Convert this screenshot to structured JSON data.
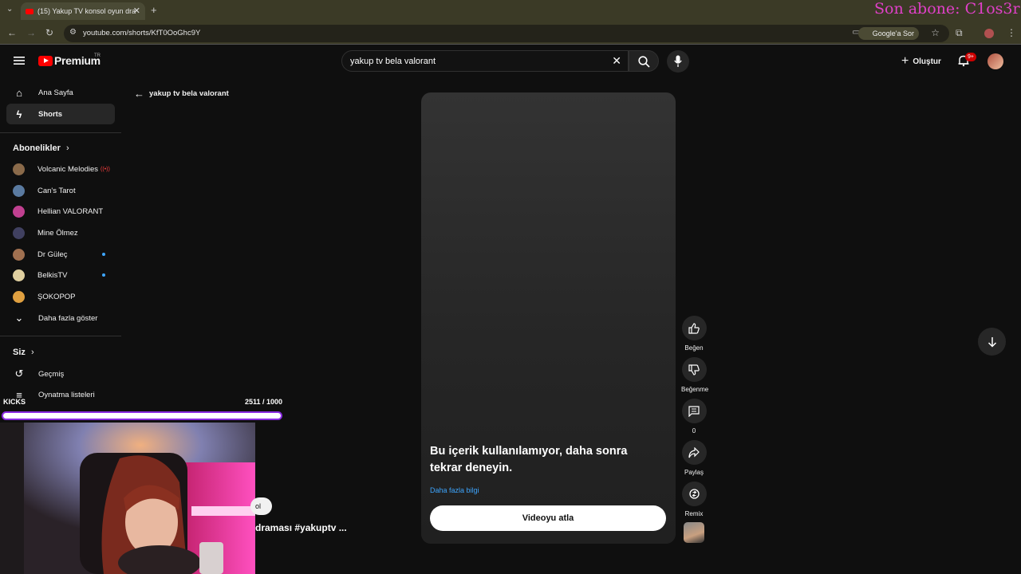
{
  "browser": {
    "tab_title": "(15) Yakup TV konsol oyun dra",
    "url": "youtube.com/shorts/KfT0OoGhc9Y",
    "google_sor": "Google'a Sor"
  },
  "stream_overlay": {
    "son_abone": "Son abone: C1os3r",
    "kicks_label": "KICKS",
    "kicks_count": "2511 / 1000",
    "kicks_progress": 1.0
  },
  "header": {
    "logo_text": "Premium",
    "logo_region": "TR",
    "search_value": "yakup tv bela valorant",
    "create_label": "Oluştur",
    "notification_badge": "9+"
  },
  "sidebar": {
    "main_items": [
      {
        "label": "Ana Sayfa",
        "icon": "home-icon"
      },
      {
        "label": "Shorts",
        "icon": "shorts-icon"
      }
    ],
    "subscriptions_title": "Abonelikler",
    "subscriptions": [
      {
        "label": "Volcanic Melodies",
        "color": "#8a6a4a",
        "live": true
      },
      {
        "label": "Can's Tarot",
        "color": "#5a7aa0",
        "live": false
      },
      {
        "label": "Hellian VALORANT",
        "color": "#c04090",
        "live": false
      },
      {
        "label": "Mine Ölmez",
        "color": "#404060",
        "live": false
      },
      {
        "label": "Dr Güleç",
        "color": "#a07050",
        "live": false,
        "dot": true
      },
      {
        "label": "BelkisTV",
        "color": "#e0d0a0",
        "live": false,
        "dot": true
      },
      {
        "label": "ŞOKOPOP",
        "color": "#e0a040",
        "live": false
      }
    ],
    "show_more": "Daha fazla göster",
    "you_title": "Siz",
    "you_items": [
      {
        "label": "Geçmiş",
        "icon": "history-icon"
      },
      {
        "label": "Oynatma listeleri",
        "icon": "playlist-icon"
      }
    ]
  },
  "main": {
    "back_label": "yakup tv bela valorant",
    "error_message": "Bu içerik kullanılamıyor, daha sonra tekrar deneyin.",
    "learn_more": "Daha fazla bilgi",
    "skip_button": "Videoyu atla",
    "bottom_title": "draması #yakuptv ...",
    "pill_text": "ol",
    "actions": {
      "like": "Beğen",
      "dislike": "Beğenme",
      "comments": "0",
      "share": "Paylaş",
      "remix": "Remix"
    }
  }
}
